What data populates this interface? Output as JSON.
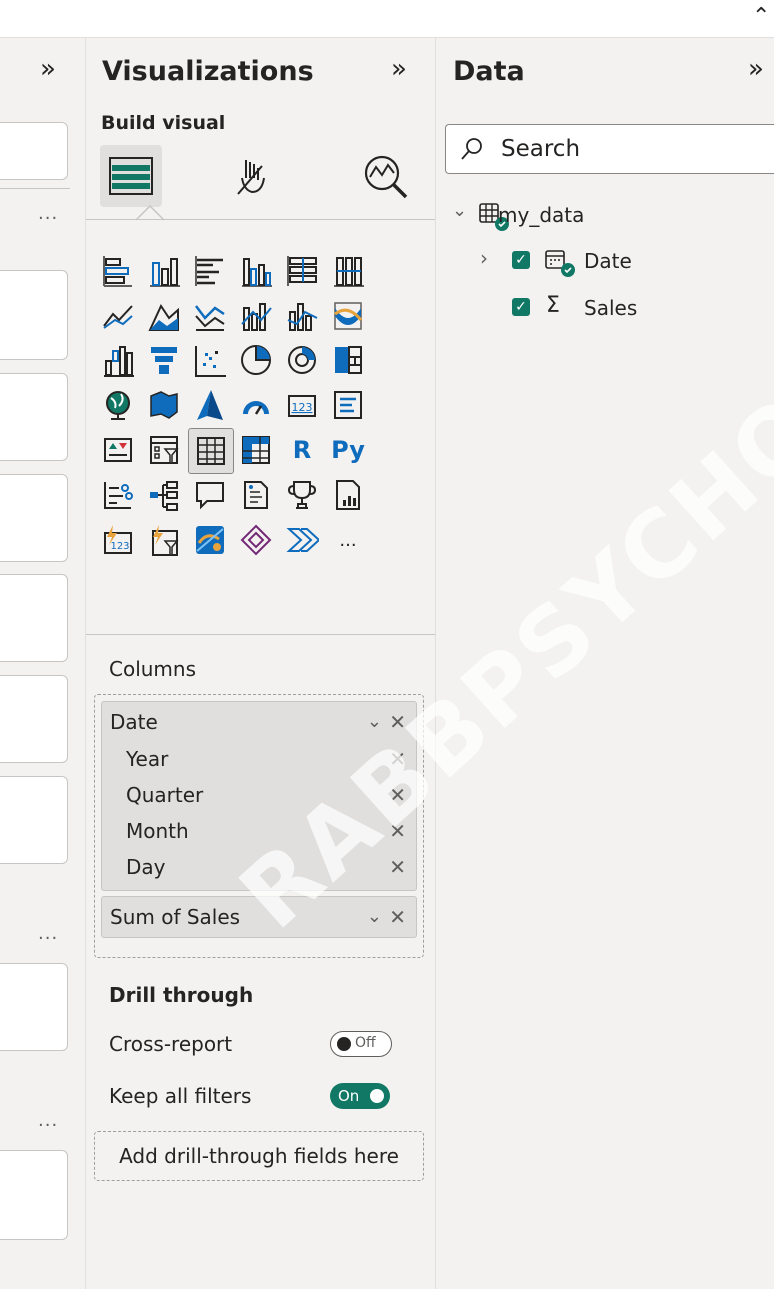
{
  "left_panel": {
    "more_label": "..."
  },
  "visualizations": {
    "title": "Visualizations",
    "build_visual": "Build visual",
    "more_visuals": "...",
    "columns_header": "Columns",
    "columns": {
      "date_field": "Date",
      "hierarchy": [
        "Year",
        "Quarter",
        "Month",
        "Day"
      ],
      "sum_field": "Sum of Sales"
    },
    "drill_through": {
      "title": "Drill through",
      "cross_report_label": "Cross-report",
      "cross_report_state": "Off",
      "keep_filters_label": "Keep all filters",
      "keep_filters_state": "On",
      "drop_zone": "Add drill-through fields here"
    }
  },
  "data_pane": {
    "title": "Data",
    "search_placeholder": "Search",
    "table_name": "my_data",
    "fields": [
      {
        "name": "Date",
        "checked": true
      },
      {
        "name": "Sales",
        "checked": true
      }
    ]
  },
  "watermark": "RABBPSYCHOL",
  "colors": {
    "accent": "#117865",
    "blue": "#0f6cbd",
    "panel_bg": "#f3f2f1"
  }
}
